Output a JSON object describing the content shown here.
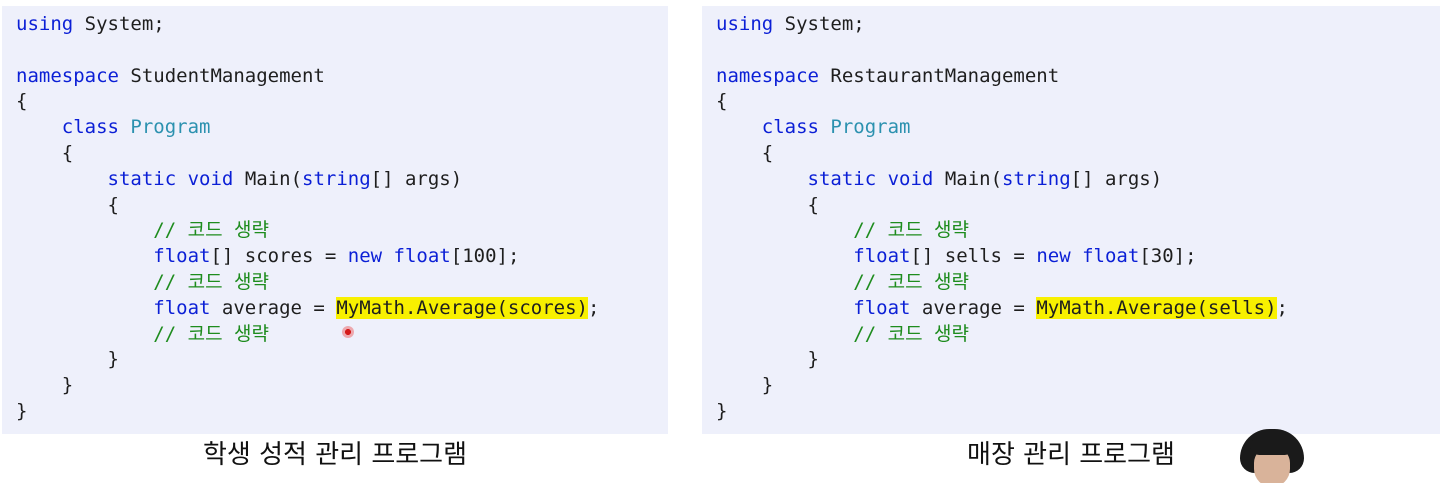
{
  "left_panel": {
    "lines": [
      [
        {
          "t": "using",
          "c": "kw"
        },
        {
          "t": " System;"
        }
      ],
      [],
      [
        {
          "t": "namespace",
          "c": "kw"
        },
        {
          "t": " StudentManagement"
        }
      ],
      [
        {
          "t": "{"
        }
      ],
      [
        {
          "t": "    "
        },
        {
          "t": "class",
          "c": "kw"
        },
        {
          "t": " "
        },
        {
          "t": "Program",
          "c": "ty"
        }
      ],
      [
        {
          "t": "    {"
        }
      ],
      [
        {
          "t": "        "
        },
        {
          "t": "static",
          "c": "kw"
        },
        {
          "t": " "
        },
        {
          "t": "void",
          "c": "kw"
        },
        {
          "t": " Main("
        },
        {
          "t": "string",
          "c": "kw"
        },
        {
          "t": "[] args)"
        }
      ],
      [
        {
          "t": "        {"
        }
      ],
      [
        {
          "t": "            "
        },
        {
          "t": "// 코드 생략",
          "c": "cm"
        }
      ],
      [
        {
          "t": "            "
        },
        {
          "t": "float",
          "c": "kw"
        },
        {
          "t": "[] scores = "
        },
        {
          "t": "new",
          "c": "kw"
        },
        {
          "t": " "
        },
        {
          "t": "float",
          "c": "kw"
        },
        {
          "t": "[100];"
        }
      ],
      [
        {
          "t": "            "
        },
        {
          "t": "// 코드 생략",
          "c": "cm"
        }
      ],
      [
        {
          "t": "            "
        },
        {
          "t": "float",
          "c": "kw"
        },
        {
          "t": " average = "
        },
        {
          "t": "MyMath.Average(scores)",
          "c": "hl"
        },
        {
          "t": ";"
        }
      ],
      [
        {
          "t": "            "
        },
        {
          "t": "// 코드 생략",
          "c": "cm"
        }
      ],
      [
        {
          "t": "        }"
        }
      ],
      [
        {
          "t": "    }"
        }
      ],
      [
        {
          "t": "}"
        }
      ]
    ],
    "caption": "학생 성적 관리 프로그램"
  },
  "right_panel": {
    "lines": [
      [
        {
          "t": "using",
          "c": "kw"
        },
        {
          "t": " System;"
        }
      ],
      [],
      [
        {
          "t": "namespace",
          "c": "kw"
        },
        {
          "t": " RestaurantManagement"
        }
      ],
      [
        {
          "t": "{"
        }
      ],
      [
        {
          "t": "    "
        },
        {
          "t": "class",
          "c": "kw"
        },
        {
          "t": " "
        },
        {
          "t": "Program",
          "c": "ty"
        }
      ],
      [
        {
          "t": "    {"
        }
      ],
      [
        {
          "t": "        "
        },
        {
          "t": "static",
          "c": "kw"
        },
        {
          "t": " "
        },
        {
          "t": "void",
          "c": "kw"
        },
        {
          "t": " Main("
        },
        {
          "t": "string",
          "c": "kw"
        },
        {
          "t": "[] args)"
        }
      ],
      [
        {
          "t": "        {"
        }
      ],
      [
        {
          "t": "            "
        },
        {
          "t": "// 코드 생략",
          "c": "cm"
        }
      ],
      [
        {
          "t": "            "
        },
        {
          "t": "float",
          "c": "kw"
        },
        {
          "t": "[] sells = "
        },
        {
          "t": "new",
          "c": "kw"
        },
        {
          "t": " "
        },
        {
          "t": "float",
          "c": "kw"
        },
        {
          "t": "[30];"
        }
      ],
      [
        {
          "t": "            "
        },
        {
          "t": "// 코드 생략",
          "c": "cm"
        }
      ],
      [
        {
          "t": "            "
        },
        {
          "t": "float",
          "c": "kw"
        },
        {
          "t": " average = "
        },
        {
          "t": "MyMath.Average(sells)",
          "c": "hl"
        },
        {
          "t": ";"
        }
      ],
      [
        {
          "t": "            "
        },
        {
          "t": "// 코드 생략",
          "c": "cm"
        }
      ],
      [
        {
          "t": "        }"
        }
      ],
      [
        {
          "t": "    }"
        }
      ],
      [
        {
          "t": "}"
        }
      ]
    ],
    "caption": "매장 관리 프로그램"
  },
  "colors": {
    "keyword": "#0b1fd6",
    "type": "#2b91af",
    "comment": "#1e8c1e",
    "highlight": "#f8f000",
    "panel_background": "#eef0fb"
  },
  "icons": {
    "pointer": "laser-pointer-dot",
    "presenter": "presenter-webcam"
  }
}
